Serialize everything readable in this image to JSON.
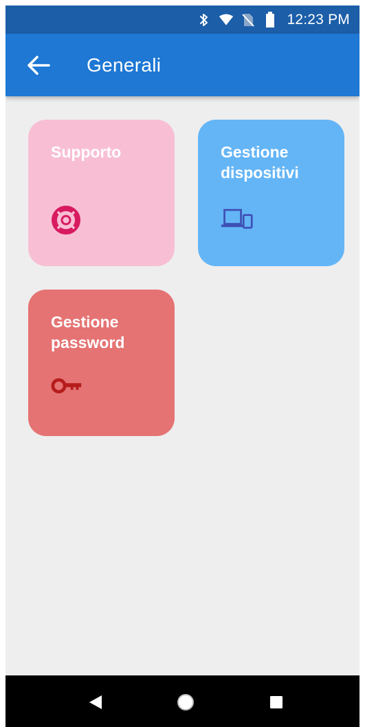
{
  "status_bar": {
    "time": "12:23 PM",
    "icons": [
      "bluetooth-icon",
      "wifi-icon",
      "no-sim-icon",
      "battery-icon"
    ]
  },
  "app_bar": {
    "title": "Generali",
    "back_icon": "arrow-left-icon"
  },
  "tiles": [
    {
      "label": "Supporto",
      "icon": "lifebuoy-icon",
      "bg_color": "#f8bfd4",
      "icon_color": "#d81b60"
    },
    {
      "label": "Gestione dispositivi",
      "icon": "devices-icon",
      "bg_color": "#64b5f6",
      "icon_color": "#3f51b5"
    },
    {
      "label": "Gestione password",
      "icon": "key-icon",
      "bg_color": "#e57373",
      "icon_color": "#b71c1c"
    }
  ],
  "nav_bar": {
    "icons": [
      "back-triangle-icon",
      "home-circle-icon",
      "recents-square-icon"
    ]
  }
}
